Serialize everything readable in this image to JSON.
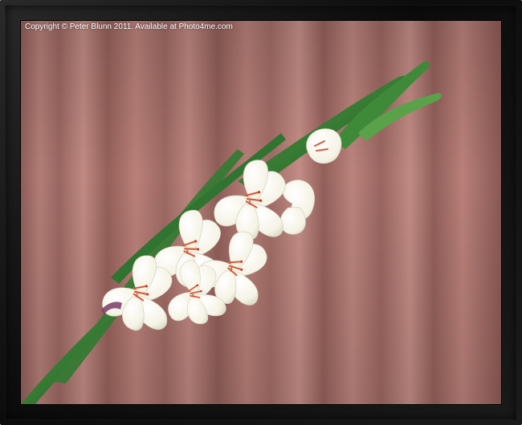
{
  "photo": {
    "copyright_text": "Copyright © Peter Blunn 2011. Available at Photo4me.com",
    "subject": "white gladiolus flower spike",
    "background": "draped dusty-rose curtain"
  },
  "colors": {
    "frame": "#111111",
    "curtain_base": "#a8716b",
    "curtain_light": "#c08a83",
    "curtain_dark": "#7a4d4a",
    "petal": "#fbfaf0",
    "petal_shade": "#dcdccc",
    "stamen": "#d9593a",
    "leaf": "#3f8a3a",
    "leaf_dark": "#1f5a22"
  }
}
